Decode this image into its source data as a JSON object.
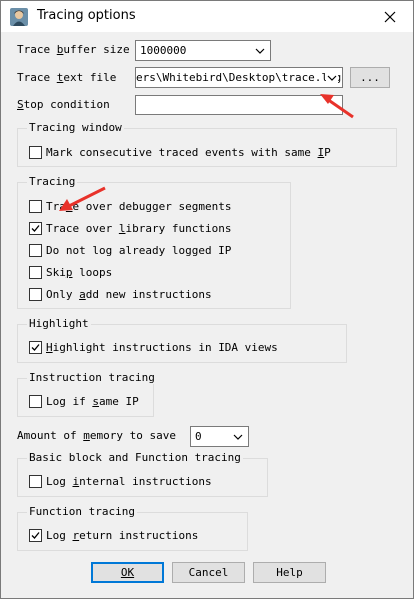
{
  "window": {
    "title": "Tracing options"
  },
  "trace_buffer": {
    "label_pre": "Trace ",
    "label_u": "b",
    "label_post": "uffer size",
    "value": "1000000"
  },
  "trace_file": {
    "label_pre": "Trace ",
    "label_u": "t",
    "label_post": "ext file",
    "value": "ers\\Whitebird\\Desktop\\trace.log",
    "browse_label": "..."
  },
  "stop_condition": {
    "label_u": "S",
    "label_post": "top condition",
    "value": ""
  },
  "tracing_window": {
    "title": "Tracing window",
    "mark_label_pre": "Mark consecutive traced events with same ",
    "mark_label_u": "I",
    "mark_label_post": "P",
    "mark_checked": false
  },
  "tracing": {
    "title": "Tracing",
    "items": [
      {
        "pre": "Tra",
        "u": "c",
        "post": "e over debugger segments",
        "checked": false
      },
      {
        "pre": "Trace over ",
        "u": "l",
        "post": "ibrary functions",
        "checked": true
      },
      {
        "pre": "Do not log already logged IP",
        "u": "",
        "post": "",
        "checked": false
      },
      {
        "pre": "Ski",
        "u": "p",
        "post": " loops",
        "checked": false
      },
      {
        "pre": "Only ",
        "u": "a",
        "post": "dd new instructions",
        "checked": false
      }
    ]
  },
  "highlight": {
    "title": "Highlight",
    "label_u": "H",
    "label_post": "ighlight instructions in IDA views",
    "checked": true
  },
  "instruction_tracing": {
    "title": "Instruction tracing",
    "label_pre": "Log if ",
    "label_u": "s",
    "label_post": "ame IP",
    "checked": false
  },
  "memory": {
    "label_pre": "Amount of ",
    "label_u": "m",
    "label_post": "emory to save",
    "value": "0"
  },
  "basic_block": {
    "title": "Basic block and Function tracing",
    "label_pre": "Log ",
    "label_u": "i",
    "label_post": "nternal instructions",
    "checked": false
  },
  "function_tracing": {
    "title": "Function tracing",
    "label_pre": "Log ",
    "label_u": "r",
    "label_post": "eturn instructions",
    "checked": true
  },
  "buttons": {
    "ok": "OK",
    "cancel": "Cancel",
    "help": "Help"
  },
  "colors": {
    "accent": "#0078d7",
    "annotation_arrow": "#e8322a"
  }
}
